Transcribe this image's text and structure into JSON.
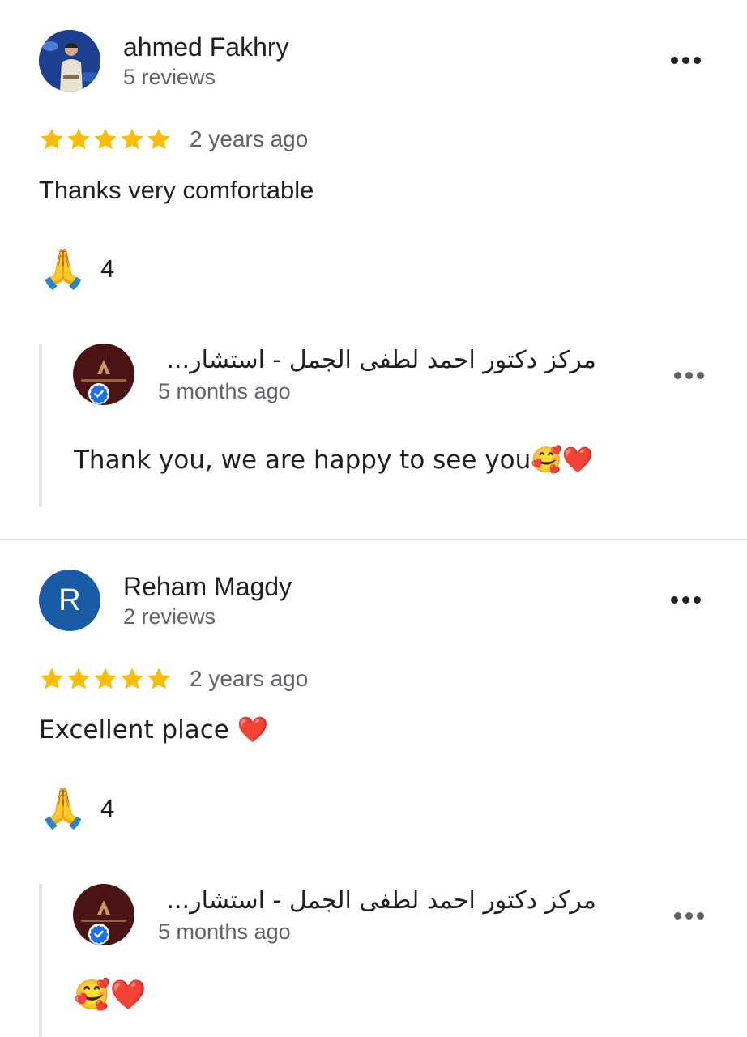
{
  "reviews": [
    {
      "author": "ahmed Fakhry",
      "meta": "5 reviews",
      "avatar": "photo",
      "avatar_letter": "",
      "rating": 5,
      "date": "2 years ago",
      "text": "Thanks very comfortable",
      "reaction": {
        "emoji": "🙏",
        "count": "4"
      },
      "owner_reply": {
        "name": "مركز دكتور احمد لطفى الجمل - استشار...",
        "date": "5 months ago",
        "text": "Thank you, we are happy to see you🥰❤️"
      }
    },
    {
      "author": "Reham Magdy",
      "meta": "2 reviews",
      "avatar": "letter",
      "avatar_letter": "R",
      "rating": 5,
      "date": "2 years ago",
      "text": "Excellent place ❤️",
      "reaction": {
        "emoji": "🙏",
        "count": "4"
      },
      "owner_reply": {
        "name": "مركز دكتور احمد لطفى الجمل - استشار...",
        "date": "5 months ago",
        "text": "🥰❤️"
      }
    }
  ],
  "colors": {
    "star": "#fbbc04",
    "secondary_text": "#5f6368",
    "avatar_letter_bg": "#1a5ba6",
    "owner_avatar_bg": "#4a1414",
    "verified_badge": "#1a73e8",
    "reply_border": "#e3e3e3"
  },
  "icons": {
    "more": "more-vert-dots-icon",
    "star": "star-icon",
    "verified": "verified-check-icon",
    "reaction": "folded-hands-icon"
  }
}
